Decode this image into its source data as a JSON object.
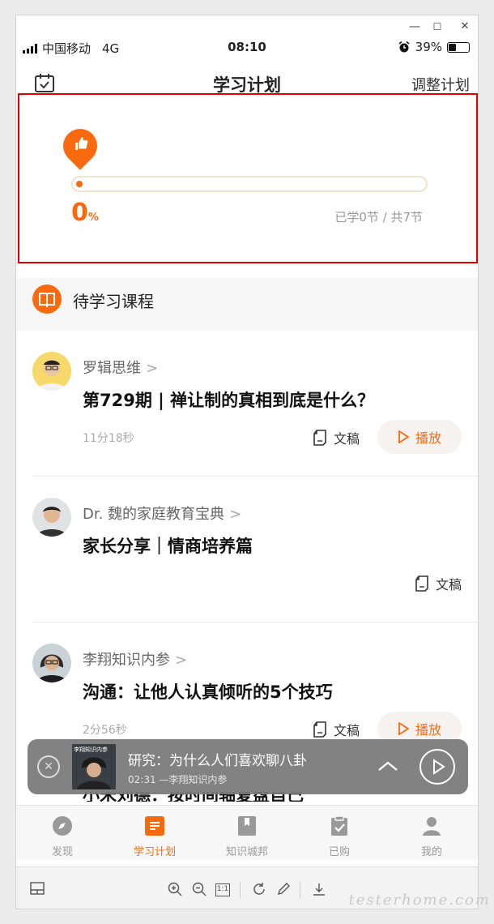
{
  "window": {
    "minimize": "—",
    "maximize": "☐",
    "close": "✕"
  },
  "status_bar": {
    "carrier": "中国移动",
    "network": "4G",
    "time": "08:10",
    "battery": "39%",
    "battery_level": 0.39
  },
  "nav": {
    "title": "学习计划",
    "right_action": "调整计划",
    "left_icon": "calendar-icon"
  },
  "progress": {
    "percent": "0",
    "percent_unit": "%",
    "stat": "已学0节 / 共7节",
    "fraction": 0
  },
  "section": {
    "title": "待学习课程"
  },
  "courses": [
    {
      "author": "罗辑思维",
      "title": "第729期 | 禅让制的真相到底是什么？",
      "duration": "11分18秒",
      "doc_label": "文稿",
      "play_label": "播放"
    },
    {
      "author": "Dr. 魏的家庭教育宝典",
      "title": "家长分享｜情商培养篇",
      "duration": "",
      "doc_label": "文稿"
    },
    {
      "author": "李翔知识内参",
      "title": "沟通：让他人认真倾听的5个技巧",
      "duration": "2分56秒",
      "doc_label": "文稿",
      "play_label": "播放"
    }
  ],
  "mini_player": {
    "title": "研究：为什么人们喜欢聊八卦",
    "time": "02:31",
    "source": "—李翔知识内参",
    "cover_text": "李翔知识内参"
  },
  "peek_title": "小米刘德：按时间轴复盘自己",
  "tabs": [
    {
      "label": "发现",
      "icon": "compass-icon"
    },
    {
      "label": "学习计划",
      "icon": "plan-icon",
      "active": true
    },
    {
      "label": "知识城邦",
      "icon": "bookmark-icon"
    },
    {
      "label": "已购",
      "icon": "purchased-icon"
    },
    {
      "label": "我的",
      "icon": "user-icon"
    }
  ],
  "toolbar": {
    "actual_size": "1:1"
  },
  "watermark": "testerhome.com",
  "colors": {
    "accent": "#f96a0e",
    "highlight_border": "#e60000"
  }
}
